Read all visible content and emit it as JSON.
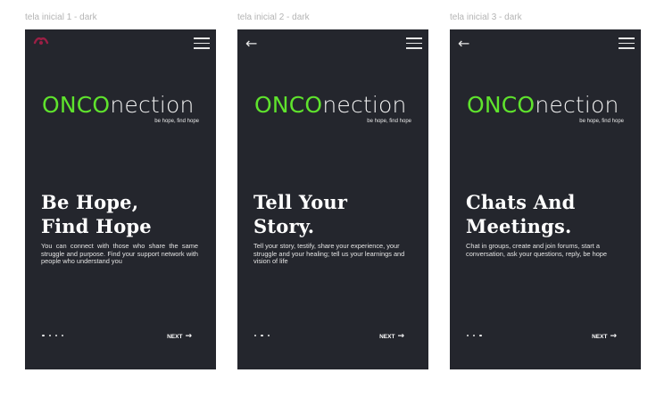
{
  "frames": [
    {
      "label": "tela inicial 1 - dark",
      "brand_accent": "ONCO",
      "brand_rest": "nection",
      "tagline": "be hope, find hope",
      "headline": "Be Hope,\nFind Hope",
      "body": "You can connect with those who share the same struggle and purpose. Find your support network with people who understand you",
      "next_label": "NEXT",
      "top_left_icon": "logo-mark",
      "menu_icon": "hamburger-menu-icon"
    },
    {
      "label": "tela inicial 2 - dark",
      "brand_accent": "ONCO",
      "brand_rest": "nection",
      "tagline": "be hope, find hope",
      "headline": "Tell Your\nStory.",
      "body": "Tell your story, testify, share your experience, your struggle and your healing; tell us your learnings and vision of life",
      "next_label": "NEXT",
      "top_left_icon": "back-arrow-icon",
      "menu_icon": "hamburger-menu-icon"
    },
    {
      "label": "tela inicial 3 - dark",
      "brand_accent": "ONCO",
      "brand_rest": "nection",
      "tagline": "be hope, find hope",
      "headline": "Chats And\nMeetings.",
      "body": "Chat in groups, create and join forums, start a conversation, ask your questions, reply, be hope",
      "next_label": "NEXT",
      "top_left_icon": "back-arrow-icon",
      "menu_icon": "hamburger-menu-icon"
    }
  ],
  "colors": {
    "screen_background": "#24262d",
    "brand_accent": "#5fe32d",
    "text": "#ffffff",
    "frame_label": "#b4b4b4",
    "logo": "#9b1f45"
  }
}
